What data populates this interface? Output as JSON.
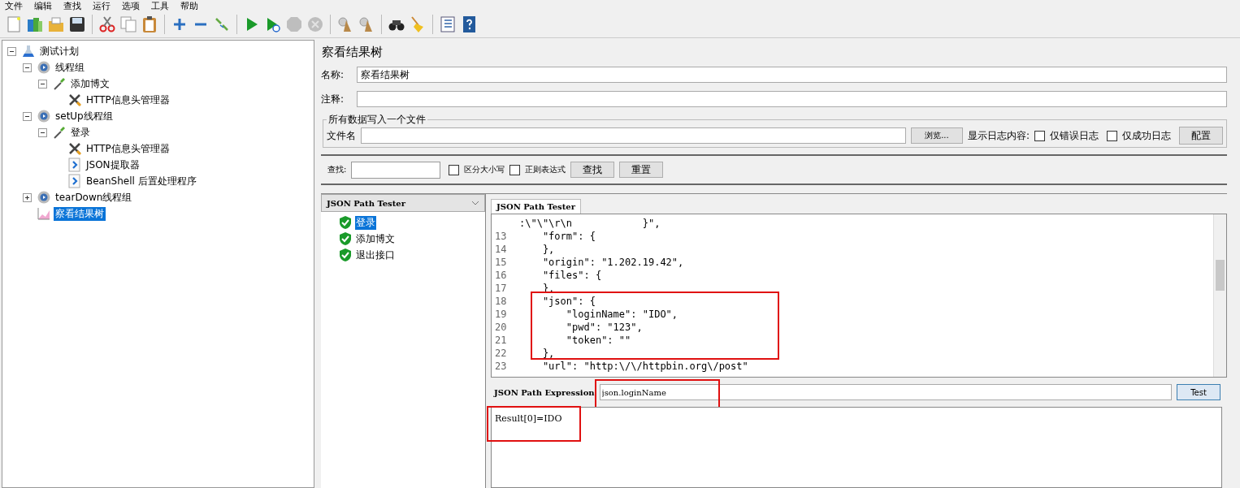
{
  "menu": [
    "文件",
    "编辑",
    "查找",
    "运行",
    "选项",
    "工具",
    "帮助"
  ],
  "toolbar": [
    [
      {
        "kind": "new",
        "disabled": false
      },
      {
        "kind": "templates",
        "disabled": false
      },
      {
        "kind": "open",
        "disabled": false
      },
      {
        "kind": "save",
        "disabled": false
      }
    ],
    [
      {
        "kind": "cut",
        "disabled": false
      },
      {
        "kind": "copy",
        "disabled": false
      },
      {
        "kind": "paste",
        "disabled": false
      }
    ],
    [
      {
        "kind": "expand",
        "disabled": false
      },
      {
        "kind": "collapse",
        "disabled": false
      },
      {
        "kind": "toggle",
        "disabled": false
      }
    ],
    [
      {
        "kind": "start",
        "disabled": false
      },
      {
        "kind": "start-no-pause",
        "disabled": false
      },
      {
        "kind": "stop",
        "disabled": true
      },
      {
        "kind": "shutdown",
        "disabled": true
      }
    ],
    [
      {
        "kind": "clear",
        "disabled": false
      },
      {
        "kind": "clear-all",
        "disabled": false
      }
    ],
    [
      {
        "kind": "search",
        "disabled": false
      },
      {
        "kind": "reset",
        "disabled": false
      }
    ],
    [
      {
        "kind": "function",
        "disabled": false
      },
      {
        "kind": "help",
        "disabled": false
      }
    ]
  ],
  "tree": [
    {
      "label": "测试计划",
      "kind": "plan",
      "expanded": true,
      "selected": false,
      "children": [
        {
          "label": "线程组",
          "kind": "threads",
          "expanded": true,
          "selected": false,
          "children": [
            {
              "label": "添加博文",
              "kind": "sampler",
              "expanded": true,
              "selected": false,
              "children": [
                {
                  "label": "HTTP信息头管理器",
                  "kind": "config",
                  "selected": false
                }
              ]
            }
          ]
        },
        {
          "label": "setUp线程组",
          "kind": "threads",
          "expanded": true,
          "selected": false,
          "children": [
            {
              "label": "登录",
              "kind": "sampler",
              "expanded": true,
              "selected": false,
              "children": [
                {
                  "label": "HTTP信息头管理器",
                  "kind": "config",
                  "selected": false
                },
                {
                  "label": "JSON提取器",
                  "kind": "post",
                  "selected": false
                },
                {
                  "label": "BeanShell 后置处理程序",
                  "kind": "post",
                  "selected": false
                }
              ]
            }
          ]
        },
        {
          "label": "tearDown线程组",
          "kind": "threads",
          "expanded": false,
          "selected": false
        },
        {
          "label": "察看结果树",
          "kind": "listener",
          "selected": true
        }
      ]
    }
  ],
  "panel": {
    "title": "察看结果树",
    "name_label": "名称:",
    "name_value": "察看结果树",
    "comment_label": "注释:",
    "file_group": {
      "legend": "所有数据写入一个文件",
      "file_label": "文件名",
      "browse": "浏览...",
      "log_label": "显示日志内容:",
      "options": [
        {
          "label": "仅错误日志",
          "checked": false
        },
        {
          "label": "仅成功日志",
          "checked": false
        }
      ],
      "configure": "配置"
    },
    "search": {
      "label": "查找:",
      "options": [
        {
          "label": "区分大小写",
          "checked": false
        },
        {
          "label": "正则表达式",
          "checked": false
        }
      ],
      "find": "查找",
      "reset": "重置"
    },
    "renderer": "JSON Path Tester",
    "results": [
      {
        "label": "登录",
        "selected": true
      },
      {
        "label": "添加博文",
        "selected": false
      },
      {
        "label": "退出接口",
        "selected": false
      }
    ],
    "tab": "JSON Path Tester",
    "code": [
      {
        "text": ":\\\"\\\"\\r\\n            }\","
      },
      {
        "number": "13",
        "text": "    \"form\": {"
      },
      {
        "number": "14",
        "text": "    },"
      },
      {
        "number": "15",
        "text": "    \"origin\": \"1.202.19.42\","
      },
      {
        "number": "16",
        "text": "    \"files\": {"
      },
      {
        "number": "17",
        "text": "    },"
      },
      {
        "number": "18",
        "text": "    \"json\": {"
      },
      {
        "number": "19",
        "text": "        \"loginName\": \"IDO\","
      },
      {
        "number": "20",
        "text": "        \"pwd\": \"123\","
      },
      {
        "number": "21",
        "text": "        \"token\": \"\""
      },
      {
        "number": "22",
        "text": "    },"
      },
      {
        "number": "23",
        "text": "    \"url\": \"http:\\/\\/httpbin.org\\/post\""
      }
    ],
    "expression_label": "JSON Path Expression",
    "expression": "json.loginName",
    "test": "Test",
    "result": "Result[0]=IDO"
  }
}
